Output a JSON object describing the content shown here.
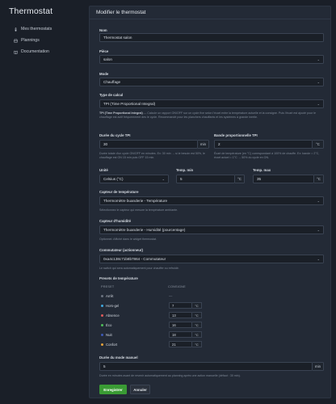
{
  "app": {
    "title": "Thermostat"
  },
  "sidebar": {
    "items": [
      {
        "label": "Mes thermostats",
        "icon": "thermometer-icon"
      },
      {
        "label": "Plannings",
        "icon": "calendar-icon"
      },
      {
        "label": "Documentation",
        "icon": "book-icon"
      }
    ]
  },
  "form": {
    "header": "Modifier le thermostat",
    "name": {
      "label": "Nom",
      "value": "Thermostat salon"
    },
    "room": {
      "label": "Pièce",
      "value": "salon"
    },
    "mode": {
      "label": "Mode",
      "value": "Chauffage"
    },
    "calc": {
      "label": "Type de calcul",
      "value": "TPI (Time Proportional Integral)",
      "help_bold": "TPI (Time Proportional Integral)",
      "help": " — Calcule un rapport ON/OFF sur un cycle fixe selon l'écart entre la température actuelle et la consigne. Puis l'écart est ajouté pour le chauffage est actif fréquemment des le cycle. Recommandé pour les planchers chauffants et les systèmes à grande inertie."
    },
    "cycle": {
      "label": "Durée du cycle TPI",
      "value": "30",
      "unit": "min",
      "help": "Durée totale d'un cycle ON/OFF en minutes. Ex: 30 min → si le besoin est 50%, le chauffage est ON 15 min puis OFF 15 min."
    },
    "band": {
      "label": "Bande proportionnelle TPI",
      "value": "2",
      "unit": "°C",
      "help": "Écart de température (en °C) correspondant à 100% de chauffe. Ex: bande = 2°C, écart actuel = 1°C → 50% du cycle en ON."
    },
    "unit_sel": {
      "label": "Unité",
      "value": "Celsius (°C)"
    },
    "tmin": {
      "label": "Temp. min",
      "value": "5",
      "unit": "°C"
    },
    "tmax": {
      "label": "Temp. max",
      "value": "35",
      "unit": "°C"
    },
    "temp_sensor": {
      "label": "Capteur de température",
      "value": "Thermomètre buanderie - Température",
      "help": "Sélectionnez le capteur qui mesure la température ambiante."
    },
    "hum_sensor": {
      "label": "Capteur d'humidité",
      "value": "Thermomètre buanderie - Humidité (pourcentage)",
      "help": "Optionnel. Affiché dans le widget thermostat."
    },
    "actuator": {
      "label": "Commutateur (actionneur)",
      "value": "0xa4c138c71b8b7864 - Commutateur",
      "help": "Le switch qui sera automatiquement pour chauffer ou refroidir."
    },
    "presets": {
      "label": "Presets de température",
      "col_preset": "PRESET",
      "col_setpoint": "CONSIGNE",
      "off_value": "—",
      "rows": [
        {
          "name": "Arrêt",
          "color": "#6b7380",
          "value": null,
          "unit": ""
        },
        {
          "name": "Hors-gel",
          "color": "#3fa9e0",
          "value": "7",
          "unit": "°C"
        },
        {
          "name": "Absence",
          "color": "#e05b5b",
          "value": "13",
          "unit": "°C"
        },
        {
          "name": "Éco",
          "color": "#4fbf5a",
          "value": "16",
          "unit": "°C"
        },
        {
          "name": "Nuit",
          "color": "#3d5ab8",
          "value": "18",
          "unit": "°C"
        },
        {
          "name": "Confort",
          "color": "#e8a33a",
          "value": "21",
          "unit": "°C"
        }
      ]
    },
    "manual": {
      "label": "Durée du mode manuel",
      "value": "5",
      "unit": "min",
      "help": "Durée en minutes avant de revenir automatiquement au planning après une action manuelle (défaut : 30 min)."
    },
    "save_label": "Enregistrer",
    "cancel_label": "Annuler"
  }
}
